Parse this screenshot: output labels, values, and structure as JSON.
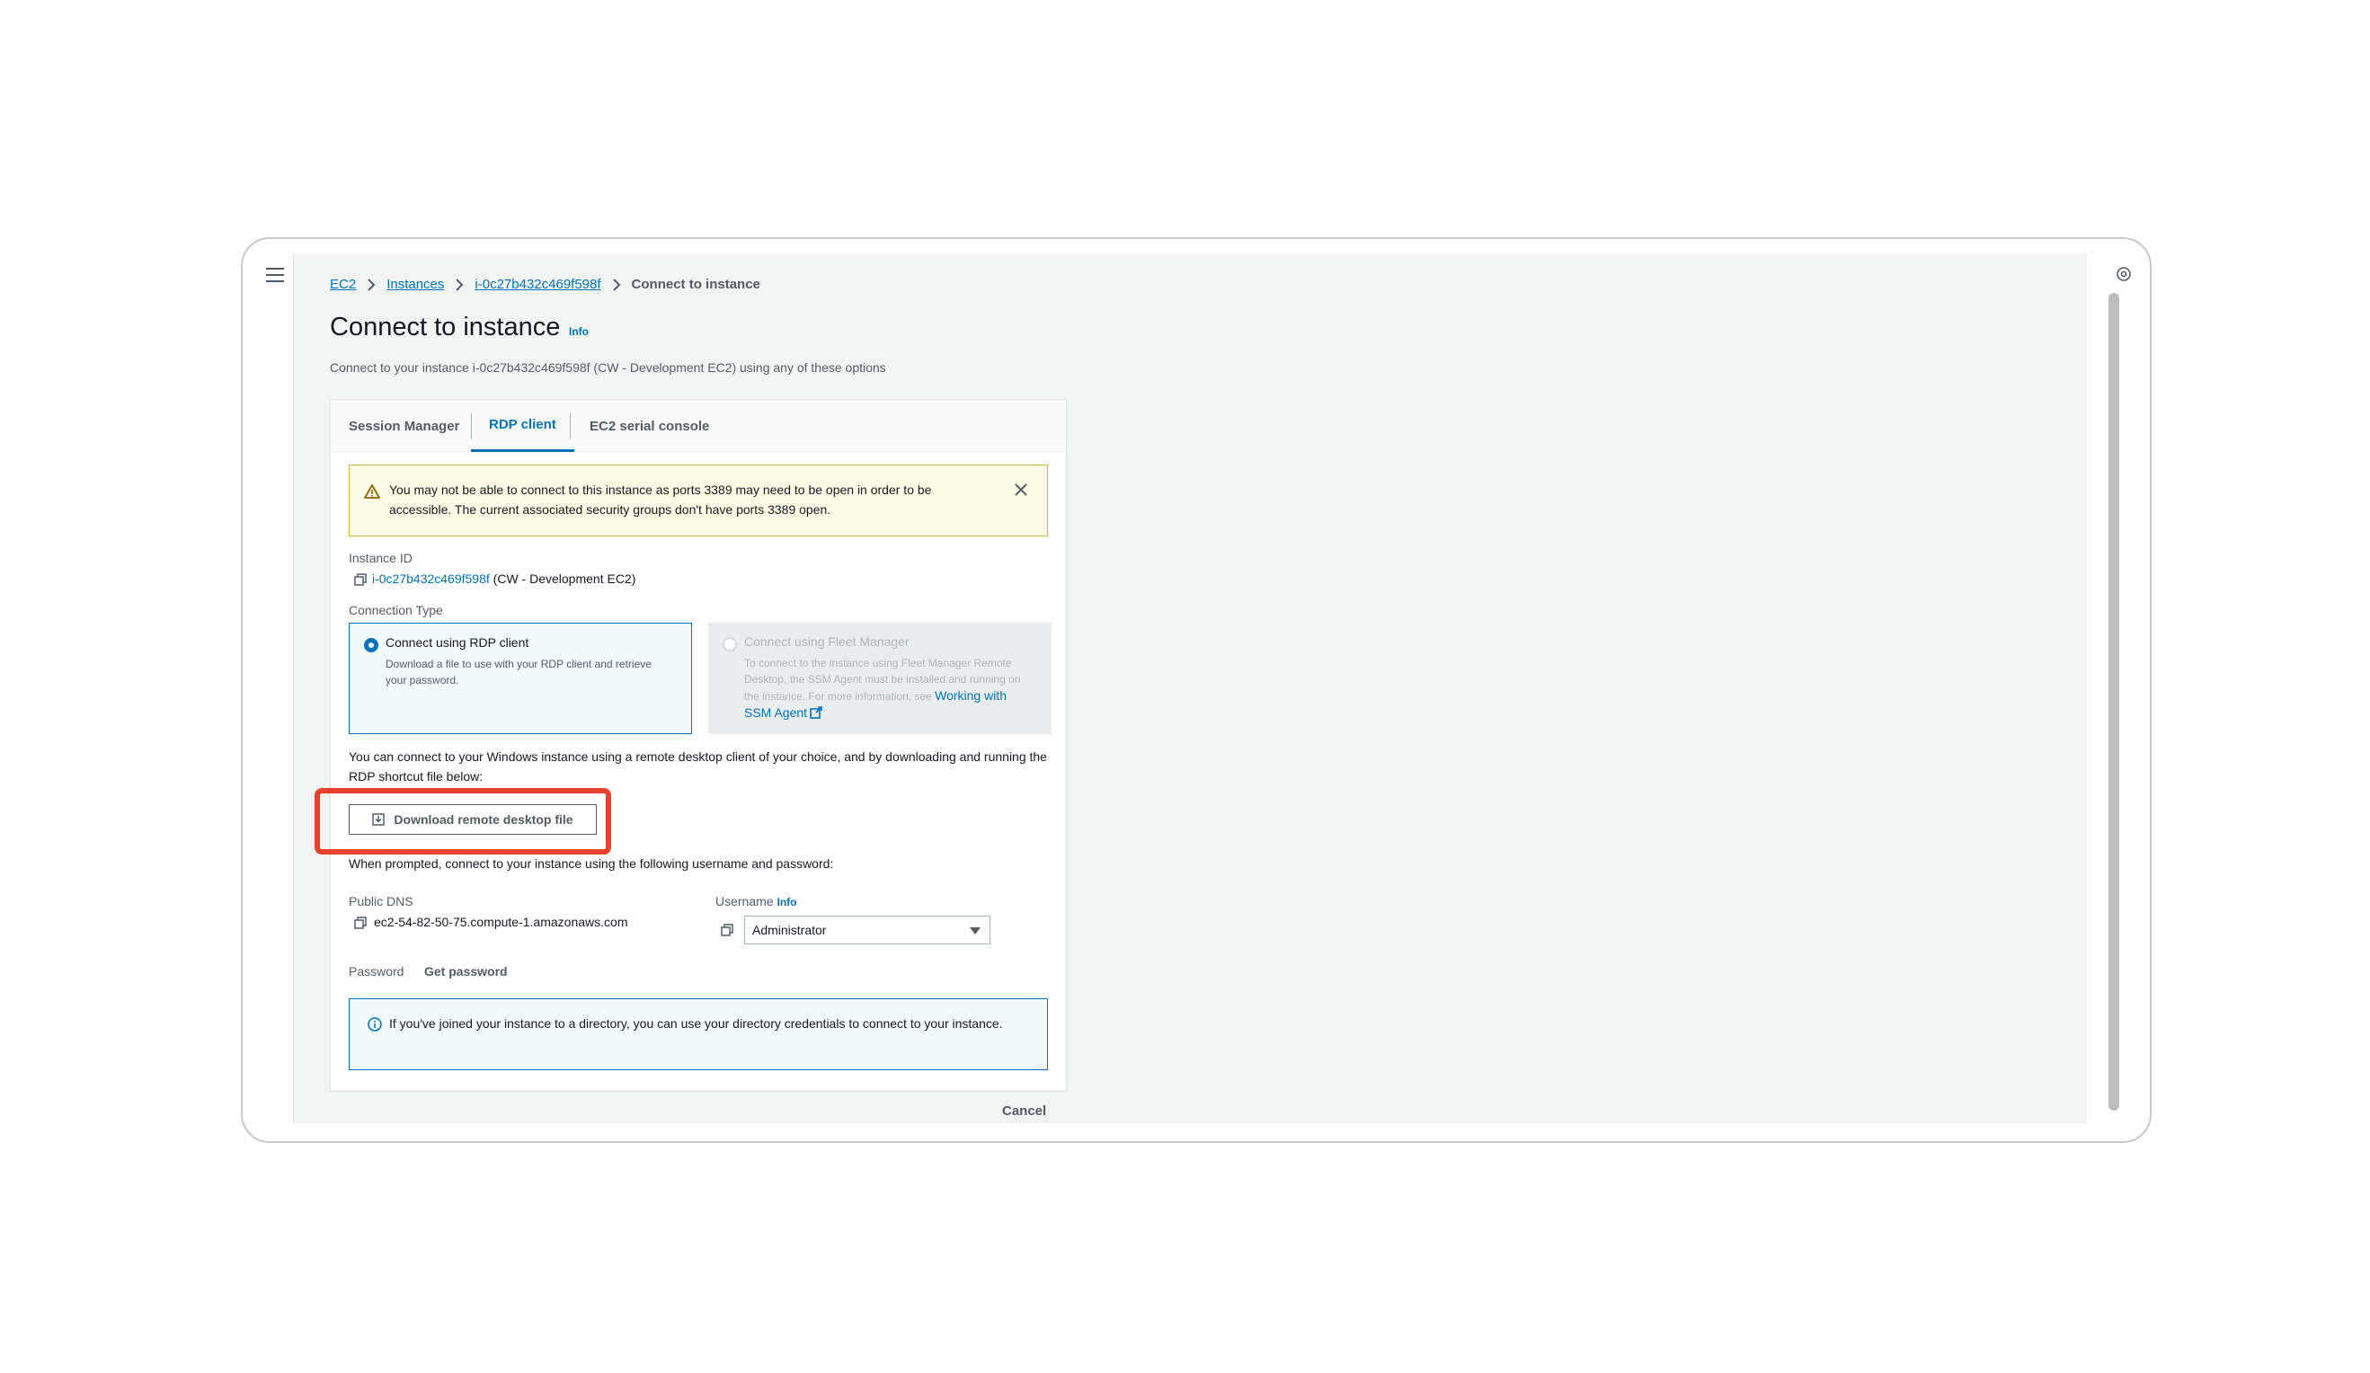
{
  "breadcrumb": {
    "ec2": "EC2",
    "instances": "Instances",
    "instance_id": "i-0c27b432c469f598f",
    "current": "Connect to instance"
  },
  "page": {
    "title": "Connect to instance",
    "info": "Info",
    "subtitle": "Connect to your instance i-0c27b432c469f598f (CW - Development EC2) using any of these options"
  },
  "tabs": [
    "Session Manager",
    "RDP client",
    "EC2 serial console"
  ],
  "active_tab": "RDP client",
  "alert": {
    "message": "You may not be able to connect to this instance as ports 3389 may need to be open in order to be accessible. The current associated security groups don't have ports 3389 open."
  },
  "instance": {
    "label": "Instance ID",
    "id": "i-0c27b432c469f598f",
    "name": "(CW - Development EC2)"
  },
  "connection_type": {
    "label": "Connection Type",
    "rdp": {
      "title": "Connect using RDP client",
      "desc": "Download a file to use with your RDP client and retrieve your password."
    },
    "fleet": {
      "title": "Connect using Fleet Manager",
      "desc": "To connect to the instance using Fleet Manager Remote Desktop, the SSM Agent must be installed and running on the instance. For more information, see",
      "link": "Working with SSM Agent"
    }
  },
  "instructions": "You can connect to your Windows instance using a remote desktop client of your choice, and by downloading and running the RDP shortcut file below:",
  "download_button": "Download remote desktop file",
  "prompt": "When prompted, connect to your instance using the following username and password:",
  "dns": {
    "label": "Public DNS",
    "value": "ec2-54-82-50-75.compute-1.amazonaws.com"
  },
  "username": {
    "label": "Username",
    "info": "Info",
    "value": "Administrator"
  },
  "password": {
    "label": "Password",
    "action": "Get password"
  },
  "info_alert": "If you've joined your instance to a directory, you can use your directory credentials to connect to your instance.",
  "cancel": "Cancel",
  "colors": {
    "link": "#0073bb",
    "warning_bg": "#fffbe6",
    "highlight": "#e8412c"
  }
}
